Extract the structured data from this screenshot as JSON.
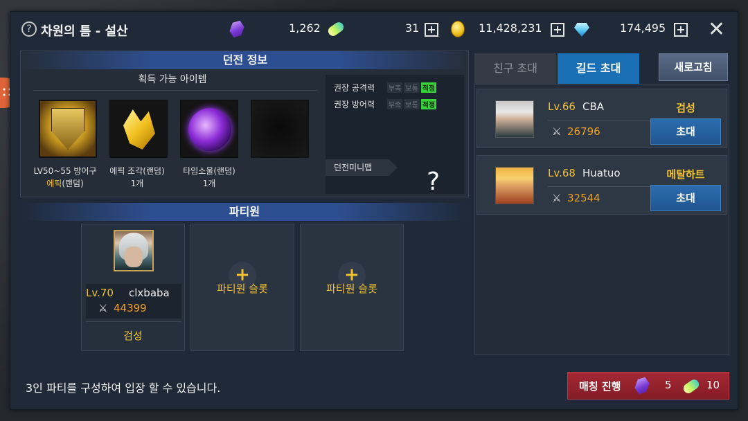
{
  "header": {
    "title": "차원의 틈 - 설산",
    "currencies": {
      "crystal": "1,262",
      "stone": "31",
      "gold": "11,428,231",
      "diamond": "174,495"
    }
  },
  "dungeon_info": {
    "section_title": "던전 정보",
    "items_title": "획득 가능 아이템",
    "items": [
      {
        "line1": "LV50~55 방어구",
        "line2_epic": "에픽",
        "line2_rest": "(랜덤)",
        "icon": "shield-icon"
      },
      {
        "line1": "에픽 조각(랜덤)",
        "line2": "1개",
        "icon": "crystal-shard-icon"
      },
      {
        "line1": "타임소울(랜덤)",
        "line2": "1개",
        "icon": "time-soul-orb-icon"
      },
      {
        "line1": "",
        "line2": "",
        "icon": "empty-slot"
      }
    ],
    "stats": [
      {
        "label": "권장 공격력",
        "tags": [
          "부족",
          "보통",
          "적정"
        ],
        "active": "적정"
      },
      {
        "label": "권장 방어력",
        "tags": [
          "부족",
          "보통",
          "적정"
        ],
        "active": "적정"
      }
    ],
    "minimap_label": "던전미니맵",
    "minimap_placeholder": "?"
  },
  "party": {
    "section_title": "파티원",
    "members": [
      {
        "level": "Lv.70",
        "name": "clxbaba",
        "power": "44399",
        "class": "검성"
      }
    ],
    "empty_slot_label": "파티원 슬롯",
    "empty_slot_plus": "+"
  },
  "invite_panel": {
    "tabs": [
      {
        "label": "친구 초대",
        "active": false
      },
      {
        "label": "길드 초대",
        "active": true
      }
    ],
    "refresh_label": "새로고침",
    "friends": [
      {
        "level": "Lv.66",
        "name": "CBA",
        "class": "검성",
        "power": "26796",
        "invite_label": "초대"
      },
      {
        "level": "Lv.68",
        "name": "Huatuo",
        "class": "메탈하트",
        "power": "32544",
        "invite_label": "초대"
      }
    ]
  },
  "footer": {
    "notice": "3인 파티를 구성하여 입장 할 수 있습니다.",
    "match_label": "매칭 진행",
    "cost_crystal": "5",
    "cost_stone": "10"
  },
  "colors": {
    "accent_gold": "#f2c230",
    "power_orange": "#f0a020",
    "tab_active": "#1a6fb4",
    "match_button": "#a32834",
    "tag_active": "#3ad23a"
  }
}
